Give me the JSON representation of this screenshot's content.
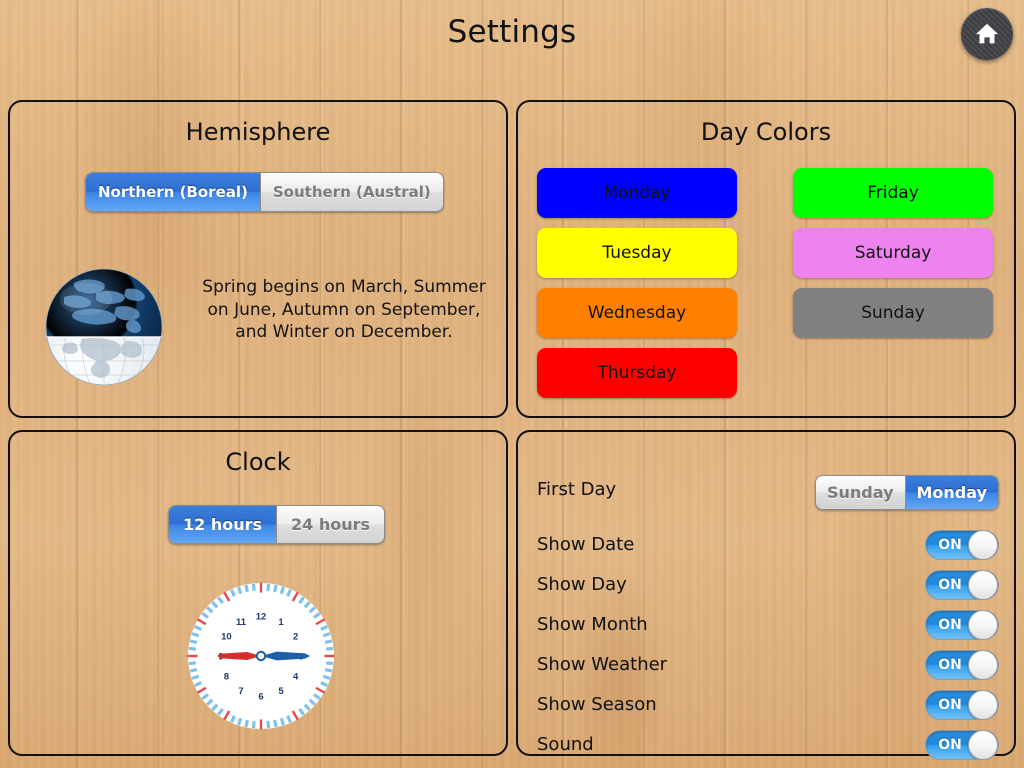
{
  "header": {
    "title": "Settings",
    "home_icon": "home-icon"
  },
  "hemisphere": {
    "title": "Hemisphere",
    "options": [
      {
        "label": "Northern (Boreal)",
        "selected": true
      },
      {
        "label": "Southern (Austral)",
        "selected": false
      }
    ],
    "description": "Spring begins on March, Summer on June, Autumn on September, and Winter on December.",
    "globe_icon": "globe-icon"
  },
  "day_colors": {
    "title": "Day Colors",
    "days": [
      {
        "label": "Monday",
        "color": "#0000FF"
      },
      {
        "label": "Tuesday",
        "color": "#FFFF00"
      },
      {
        "label": "Wednesday",
        "color": "#FF7F00"
      },
      {
        "label": "Thursday",
        "color": "#FF0000"
      },
      {
        "label": "Friday",
        "color": "#00FF00"
      },
      {
        "label": "Saturday",
        "color": "#EE82EE"
      },
      {
        "label": "Sunday",
        "color": "#808080"
      }
    ]
  },
  "clock": {
    "title": "Clock",
    "options": [
      {
        "label": "12 hours",
        "selected": true
      },
      {
        "label": "24 hours",
        "selected": false
      }
    ],
    "face": {
      "hours": [
        "12",
        "1",
        "2",
        "3",
        "4",
        "5",
        "6",
        "7",
        "8",
        "9",
        "10",
        "11"
      ],
      "minute_marks": [
        "5",
        "10",
        "15",
        "20",
        "25",
        "30",
        "35",
        "40",
        "45",
        "50",
        "55",
        "60"
      ],
      "hour_hand_value": 9,
      "minute_hand_value": 15,
      "hour_hand_color": "#D32F2F",
      "minute_hand_color": "#1E5FA8",
      "tick_color": "#7FC1EC",
      "numeral_color": "#1B3A6B"
    }
  },
  "display": {
    "first_day": {
      "label": "First Day",
      "options": [
        {
          "label": "Sunday",
          "selected": false
        },
        {
          "label": "Monday",
          "selected": true
        }
      ]
    },
    "toggles": [
      {
        "label": "Show Date",
        "state": "ON"
      },
      {
        "label": "Show Day",
        "state": "ON"
      },
      {
        "label": "Show Month",
        "state": "ON"
      },
      {
        "label": "Show Weather",
        "state": "ON"
      },
      {
        "label": "Show Season",
        "state": "ON"
      },
      {
        "label": "Sound",
        "state": "ON"
      }
    ]
  },
  "theme": {
    "accent": "#2F6FD0",
    "background_wood": "#DFB07C",
    "panel_border": "#111111"
  }
}
